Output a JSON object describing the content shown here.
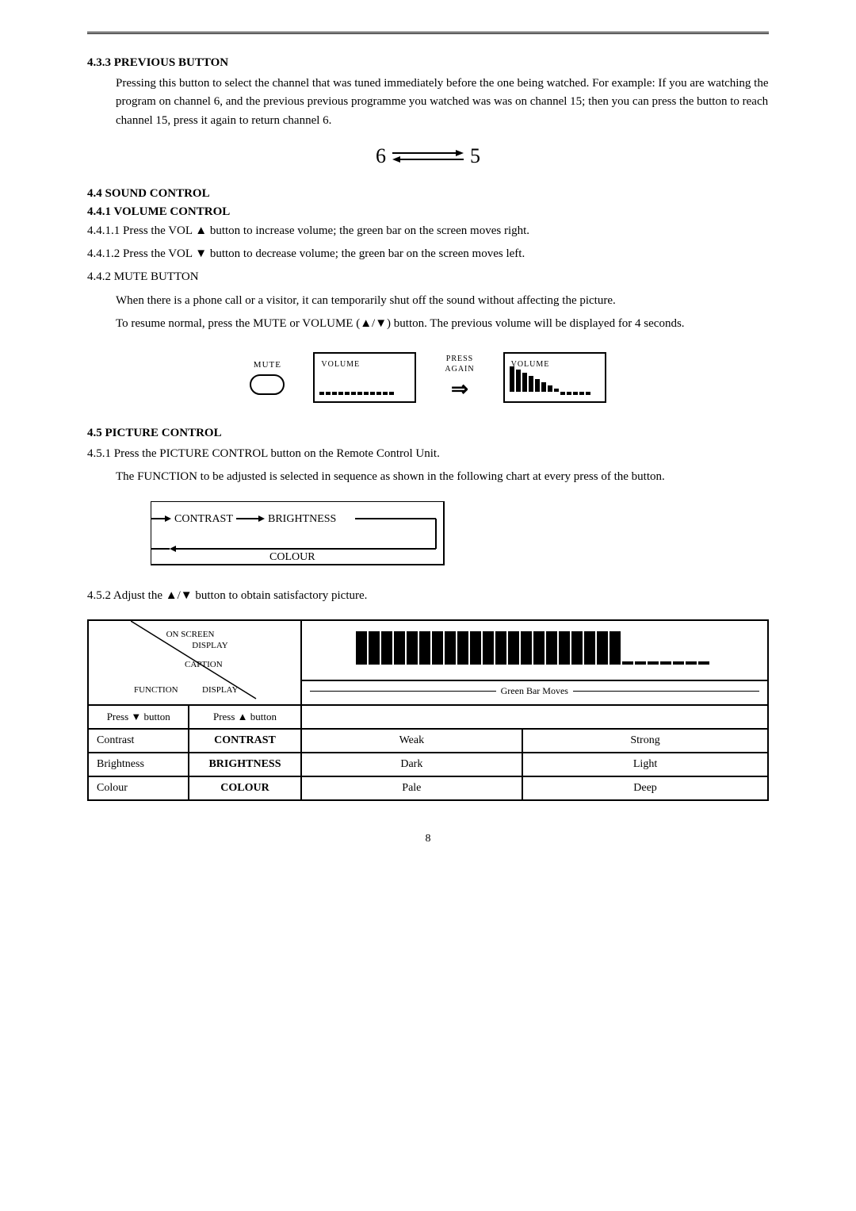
{
  "top_border": true,
  "section_4_3_3": {
    "heading": "4.3.3 PREVIOUS BUTTON",
    "para1": "Pressing this button to select the channel that was tuned immediately before the one being watched. For example: If you are watching the program on channel 6, and the previous previous programme you watched was was on channel 15; then you can press the button to reach channel 15, press it again to return channel 6.",
    "channel_from": "6",
    "channel_to": "5"
  },
  "section_4_4": {
    "heading": "4.4 SOUND CONTROL",
    "sub_heading": "4.4.1 VOLUME CONTROL",
    "line1": "4.4.1.1 Press the VOL ▲ button to increase volume; the green bar on the screen moves right.",
    "line2": "4.4.1.2 Press the VOL ▼  button to decrease volume; the green bar on the screen moves left.",
    "line3": "4.4.2 MUTE BUTTON",
    "mute_para1": "When there is a phone call or a visitor, it can temporarily shut off the sound without affecting the picture.",
    "mute_para2": "To resume normal, press the MUTE or VOLUME (▲/▼) button. The previous volume will be displayed for 4 seconds.",
    "mute_label": "MUTE",
    "volume_label": "VOLUME",
    "press_again": "PRESS\nAGAIN",
    "volume_label2": "VOLUME"
  },
  "section_4_5": {
    "heading": "4.5 PICTURE CONTROL",
    "line1": "4.5.1 Press the PICTURE CONTROL button on the Remote Control Unit.",
    "line2": "The FUNCTION to be adjusted is selected in sequence as shown in the following chart at every press of the button.",
    "flow_contrast": "CONTRAST",
    "flow_brightness": "BRIGHTNESS",
    "flow_colour": "COLOUR",
    "line3_prefix": "4.5.2  Adjust the ▲/▼ button to obtain satisfactory picture.",
    "table": {
      "header_on_screen": "ON SCREEN",
      "header_display_top": "DISPLAY",
      "header_caption": "CAPTION",
      "header_function": "FUNCTION",
      "header_display_bottom": "DISPLAY",
      "header_press_down": "Press ▼ button",
      "header_press_up": "Press ▲ button",
      "green_bar_label": "Green Bar Moves",
      "rows": [
        {
          "function": "Contrast",
          "display": "CONTRAST",
          "press_down": "Weak",
          "press_up": "Strong"
        },
        {
          "function": "Brightness",
          "display": "BRIGHTNESS",
          "press_down": "Dark",
          "press_up": "Light"
        },
        {
          "function": "Colour",
          "display": "COLOUR",
          "press_down": "Pale",
          "press_up": "Deep"
        }
      ]
    }
  },
  "page_number": "8"
}
